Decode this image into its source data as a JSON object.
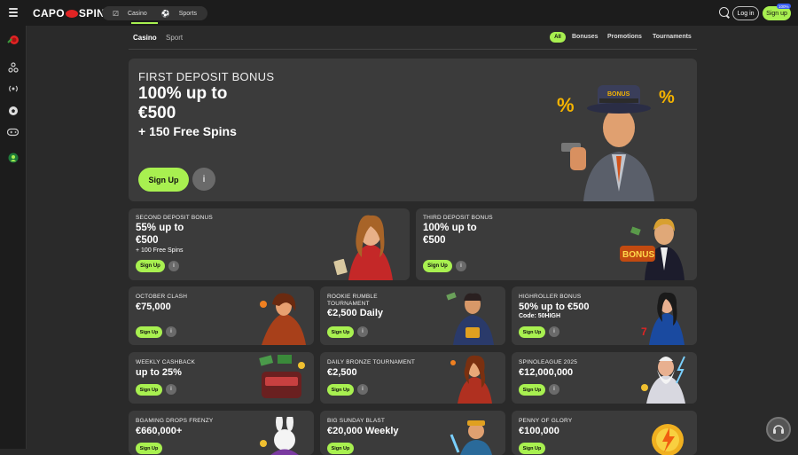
{
  "header": {
    "logo_left": "CAPO",
    "logo_right": "SPIN",
    "nav": [
      {
        "label": "Casino",
        "icon": "dice-icon"
      },
      {
        "label": "Sports",
        "icon": "ball-icon"
      }
    ],
    "login": "Log in",
    "signup": "Sign up",
    "badge": "100%"
  },
  "subnav": {
    "tabs": [
      "Casino",
      "Sport"
    ],
    "all": "All",
    "links": [
      "Bonuses",
      "Promotions",
      "Tournaments"
    ]
  },
  "hero": {
    "title": "FIRST DEPOSIT BONUS",
    "line1": "100% up to",
    "line2": "€500",
    "line3": "+ 150 Free Spins",
    "button": "Sign Up",
    "info": "i"
  },
  "cards_large": [
    {
      "title": "SECOND DEPOSIT BONUS",
      "h1": "55% up to",
      "h2": "€500",
      "sub": "+ 100 Free Spins",
      "button": "Sign Up"
    },
    {
      "title": "THIRD DEPOSIT BONUS",
      "h1": "100% up to",
      "h2": "€500",
      "sub": "",
      "button": "Sign Up"
    }
  ],
  "cards": [
    {
      "title": "OCTOBER CLASH",
      "h1": "€75,000",
      "sub": "",
      "button": "Sign Up"
    },
    {
      "title": "ROOKIE RUMBLE TOURNAMENT",
      "h1": "€2,500 Daily",
      "sub": "",
      "button": "Sign Up"
    },
    {
      "title": "HIGHROLLER BONUS",
      "h1": "50% up to €500",
      "sub": "Code: 50HIGH",
      "button": "Sign Up"
    },
    {
      "title": "WEEKLY CASHBACK",
      "h1": "up to 25%",
      "sub": "",
      "button": "Sign Up"
    },
    {
      "title": "DAILY BRONZE TOURNAMENT",
      "h1": "€2,500",
      "sub": "",
      "button": "Sign Up"
    },
    {
      "title": "SPINOLEAGUE 2025",
      "h1": "€12,000,000",
      "sub": "",
      "button": "Sign Up"
    },
    {
      "title": "BGAMING DROPS FRENZY",
      "h1": "€660,000+",
      "sub": "",
      "button": "Sign Up"
    },
    {
      "title": "BIG SUNDAY BLAST",
      "h1": "€20,000 Weekly",
      "sub": "",
      "button": "Sign Up"
    },
    {
      "title": "PENNY OF GLORY",
      "h1": "€100,000",
      "sub": "",
      "button": "Sign Up"
    }
  ],
  "hero_art": {
    "hat_text": "BONUS",
    "symbols": [
      "%",
      "%"
    ]
  },
  "third_art": {
    "sign_text": "BONUS"
  },
  "colors": {
    "accent": "#a8f050",
    "card": "#3b3b3b",
    "bg": "#2a2a2a",
    "brand_red": "#e02424"
  }
}
